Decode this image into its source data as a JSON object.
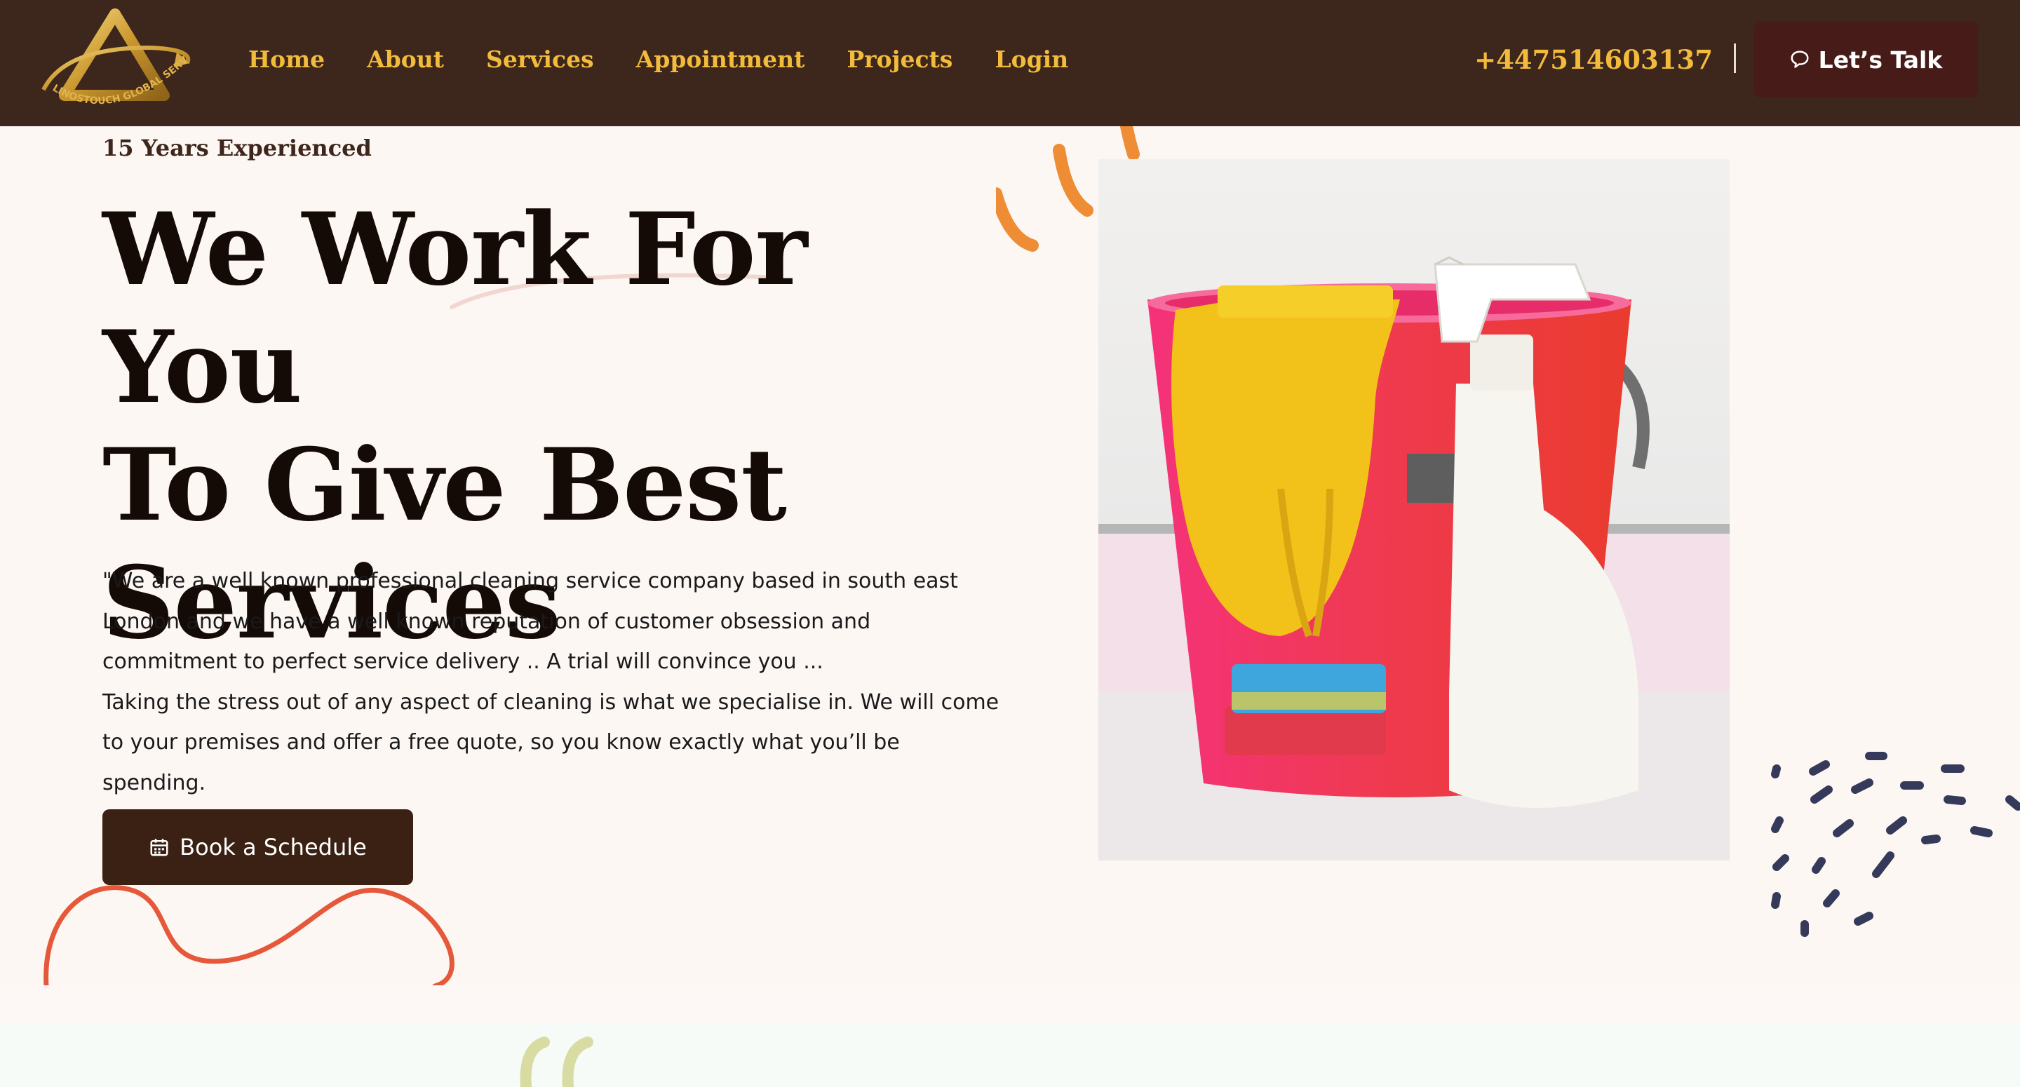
{
  "header": {
    "logo_text": "LINOSTOUCH GLOBAL SERVICES",
    "nav": [
      {
        "label": "Home"
      },
      {
        "label": "About"
      },
      {
        "label": "Services"
      },
      {
        "label": "Appointment"
      },
      {
        "label": "Projects"
      },
      {
        "label": "Login"
      }
    ],
    "phone": "+447514603137",
    "cta_label": "Let’s Talk"
  },
  "hero": {
    "eyebrow": "15 Years Experienced",
    "title_lines": [
      "We Work For You",
      "To Give Best",
      "Services"
    ],
    "paragraph_lines": [
      "\"We are a well known professional cleaning service company based in south east London and we have a well known reputation of customer obsession and commitment to perfect service delivery .. A trial will convince you ...",
      "Taking the stress out of any aspect of cleaning is what we specialise in. We will come to your premises and offer a free quote, so you know exactly what you’ll be spending."
    ],
    "cta_label": "Book a Schedule",
    "image_icon": "cleaning-supplies-photo"
  },
  "colors": {
    "header_bg": "#3d261b",
    "nav_gold": "#f2bb3c",
    "talk_btn": "#471c18",
    "book_btn": "#3a2114",
    "accent_orange": "#ee8d35",
    "accent_red": "#e5593a",
    "dots_navy": "#353a5a",
    "page_bg": "#fdf7f4"
  }
}
